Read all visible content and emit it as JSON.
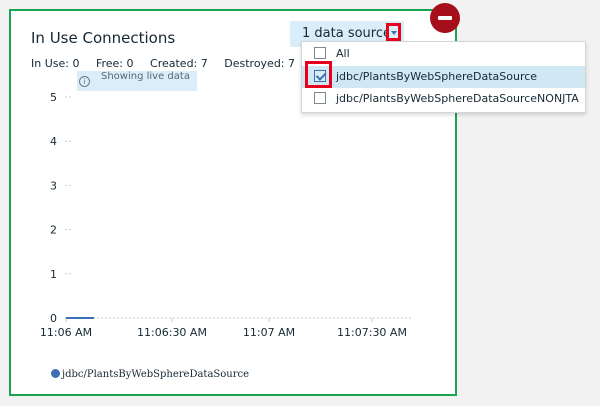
{
  "widget": {
    "title": "In Use Connections",
    "stats": [
      "In Use: 0",
      "Free: 0",
      "Created: 7",
      "Destroyed: 7"
    ],
    "live_notice": "Showing live data"
  },
  "datasource_menu": {
    "button_label": "1 data source",
    "items": [
      {
        "label": "All",
        "checked": false
      },
      {
        "label": "jdbc/PlantsByWebSphereDataSource",
        "checked": true
      },
      {
        "label": "jdbc/PlantsByWebSphereDataSourceNONJTA",
        "checked": false
      }
    ]
  },
  "chart_data": {
    "type": "line",
    "title": "",
    "ylim": [
      0,
      5
    ],
    "y_ticks": [
      "5",
      "4",
      "3",
      "2",
      "1",
      "0"
    ],
    "x_ticks": [
      "11:06 AM",
      "11:06:30 AM",
      "11:07 AM",
      "11:07:30 AM"
    ],
    "series": [
      {
        "name": "jdbc/PlantsByWebSphereDataSource",
        "color": "#3d70b2",
        "x": [
          "11:06 AM"
        ],
        "values": [
          0
        ]
      }
    ],
    "grid": true,
    "legend": "bottom-left"
  },
  "colors": {
    "card_border": "#1aa350",
    "highlight": "#e8001c",
    "remove_button": "#a50e1a",
    "series": "#3d70b2"
  }
}
